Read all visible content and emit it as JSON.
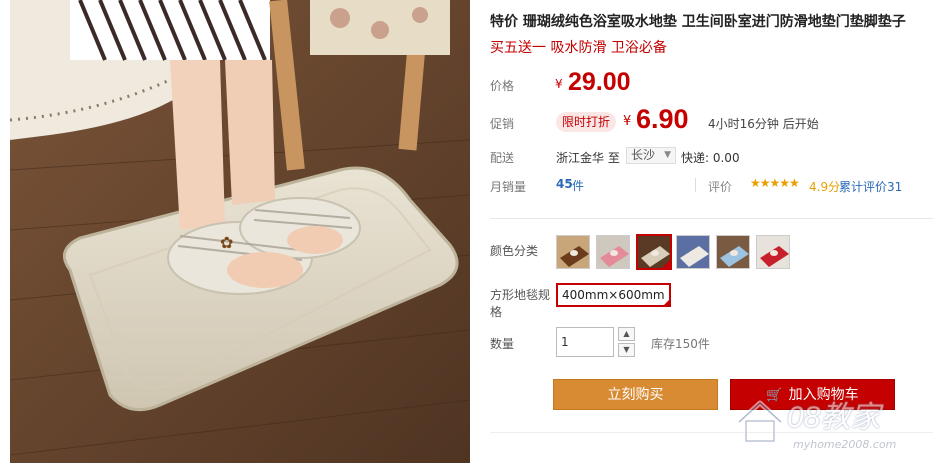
{
  "product": {
    "title": "特价 珊瑚绒纯色浴室吸水地垫 卫生间卧室进门防滑地垫门垫脚垫子",
    "subtitle": "买五送一 吸水防滑 卫浴必备"
  },
  "price": {
    "label": "价格",
    "currency": "¥",
    "value": "29.00"
  },
  "promo": {
    "label": "促销",
    "badge": "限时打折",
    "currency": "¥",
    "value": "6.90",
    "countdown": "4小时16分钟 后开始"
  },
  "shipping": {
    "label": "配送",
    "from": "浙江金华 至",
    "to": "长沙",
    "fee": "快递: 0.00"
  },
  "sales": {
    "label": "月销量",
    "value": "45",
    "unit": "件",
    "rating_label": "评价",
    "stars": "★★★★★",
    "rating_value": "4.9分",
    "review_link": "累计评价31"
  },
  "options": {
    "color_label": "颜色分类",
    "size_label": "方形地毯规格",
    "size_value": "400mm×600mm",
    "swatches": [
      {
        "name": "brown",
        "rug": "#6b3b1c",
        "floor": "#c9a57a",
        "selected": false
      },
      {
        "name": "pink",
        "rug": "#e58a98",
        "floor": "#cfc8bf",
        "selected": false
      },
      {
        "name": "beige",
        "rug": "#d8cdb8",
        "floor": "#5a3a24",
        "selected": true
      },
      {
        "name": "white-blue",
        "rug": "#edeae5",
        "floor": "#5b6fa3",
        "selected": false
      },
      {
        "name": "light-blue",
        "rug": "#9cc3e2",
        "floor": "#7a5a40",
        "selected": false
      },
      {
        "name": "red",
        "rug": "#c7202c",
        "floor": "#e8e2dc",
        "selected": false
      }
    ]
  },
  "quantity": {
    "label": "数量",
    "value": "1",
    "up": "▲",
    "down": "▼",
    "stock": "库存150件"
  },
  "actions": {
    "buy_now": "立刻购买",
    "add_to_cart": "加入购物车",
    "cart_glyph": "🛒"
  },
  "watermark": {
    "brand": "08教家",
    "url": "myhome2008.com"
  },
  "colors": {
    "accent_red": "#c40000",
    "buy_orange": "#d98b34",
    "link_blue": "#2a6ab6",
    "star_gold": "#e8a000"
  }
}
